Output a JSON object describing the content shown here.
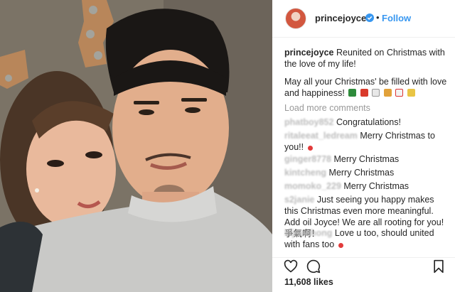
{
  "post": {
    "username": "princejoyce",
    "follow_label": "Follow",
    "separator": "•",
    "caption_line1": "Reunited on Christmas with the love of my life!",
    "caption_line2": "May all your Christmas' be filled with love and happiness!",
    "load_more": "Load more comments",
    "likes": "11,608 likes"
  },
  "comments": [
    {
      "user": "phatboy852",
      "text": "Congratulations!"
    },
    {
      "user": "ritaleeat_ledream",
      "text": "Merry Christmas to you!!"
    },
    {
      "user": "ginger8778",
      "text": "Merry Christmas"
    },
    {
      "user": "kintcheng",
      "text": "Merry Christmas"
    },
    {
      "user": "momoko_229",
      "text": "Merry Christmas"
    },
    {
      "user": "s2janie",
      "text": "Just seeing you happy makes this Christmas even more meaningful. Add oil Joyce! We are all rooting for you! 爭氣啊！"
    },
    {
      "user": "bijouchong",
      "text": "Love u too, should united with fans too"
    }
  ],
  "icons": {
    "verified": "verified-badge-icon",
    "like": "heart-icon",
    "comment": "comment-icon",
    "save": "bookmark-icon"
  },
  "colors": {
    "link": "#3897f0",
    "muted": "#999999",
    "verified": "#3897f0"
  }
}
